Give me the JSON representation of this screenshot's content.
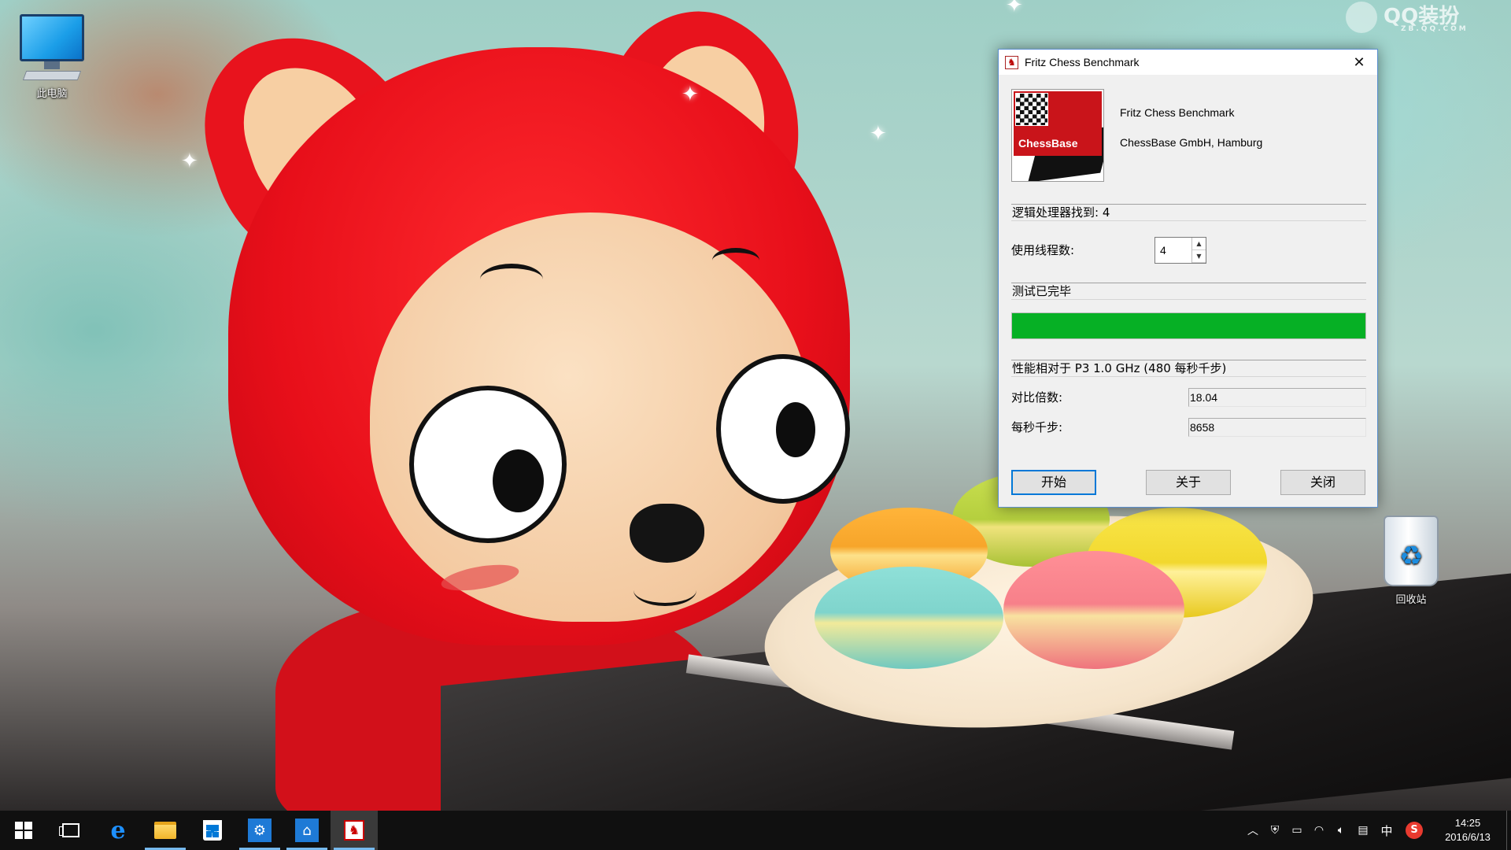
{
  "desktop": {
    "icons": [
      {
        "id": "this-pc",
        "label": "此电脑"
      },
      {
        "id": "recycle-bin",
        "label": "回收站"
      }
    ],
    "watermark": {
      "text": "QQ装扮",
      "sub": "ZB.QQ.COM"
    }
  },
  "dialog": {
    "title": "Fritz Chess Benchmark",
    "logo_text": "ChessBase",
    "product_name": "Fritz Chess Benchmark",
    "company": "ChessBase GmbH, Hamburg",
    "logical_processors_label": "逻辑处理器找到: 4",
    "threads_label": "使用线程数:",
    "threads_value": "4",
    "status_text": "测试已完毕",
    "progress": 100,
    "perf_header": "性能相对于 P3 1.0 GHz (480 每秒千步)",
    "ratio_label": "对比倍数:",
    "ratio_value": "18.04",
    "kns_label": "每秒千步:",
    "kns_value": "8658",
    "buttons": {
      "start": "开始",
      "about": "关于",
      "close": "关闭"
    }
  },
  "taskbar": {
    "ime": "中",
    "time": "14:25",
    "date": "2016/6/13"
  },
  "colors": {
    "progress_fill": "#06b025",
    "taskbar": "#101010",
    "focus_border": "#0078d7"
  }
}
